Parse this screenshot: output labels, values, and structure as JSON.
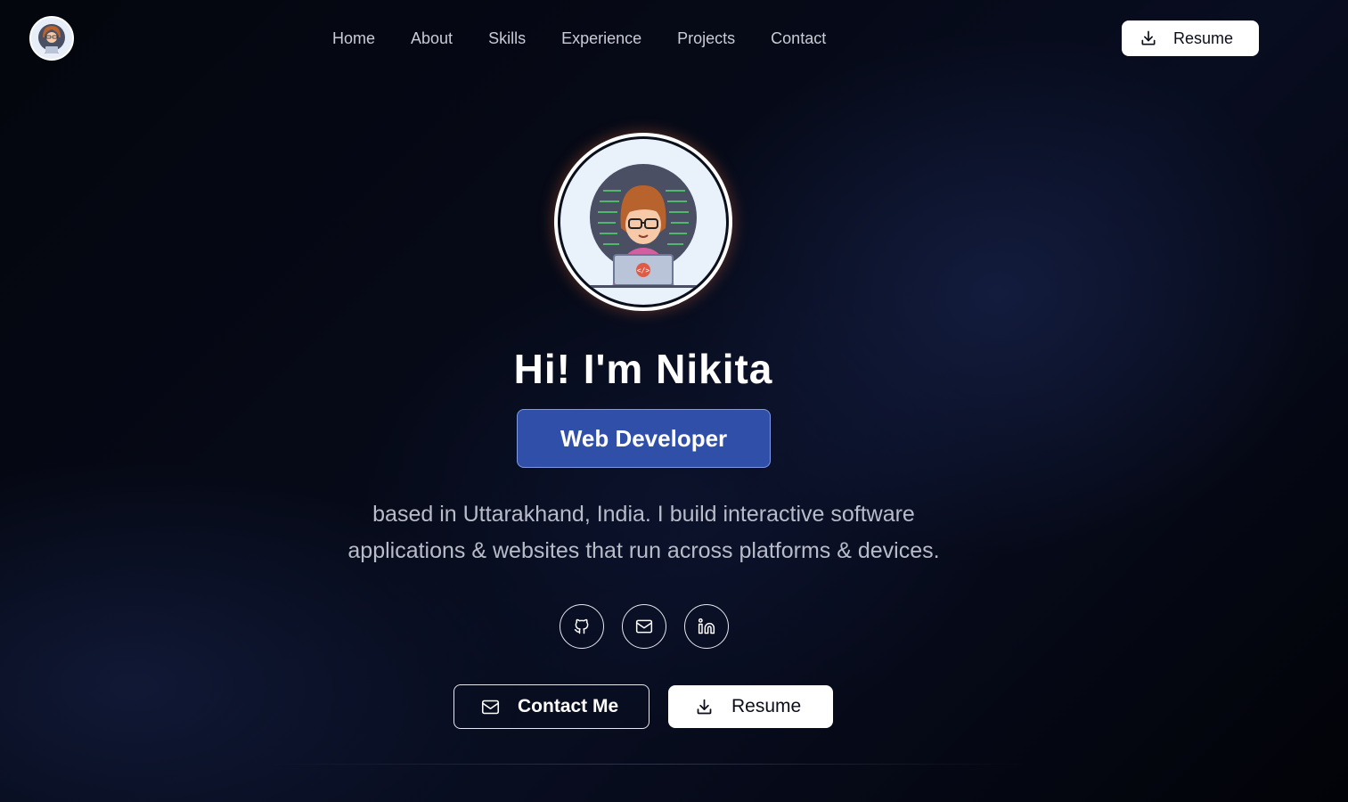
{
  "header": {
    "logo_icon": "avatar-icon",
    "nav": [
      "Home",
      "About",
      "Skills",
      "Experience",
      "Projects",
      "Contact"
    ],
    "resume_label": "Resume",
    "resume_icon": "download-icon"
  },
  "hero": {
    "title": "Hi! I'm Nikita",
    "role": "Web Developer",
    "bio_line1": "based in Uttarakhand, India. I build interactive software",
    "bio_line2": "applications & websites that run across platforms & devices.",
    "socials": [
      "github-icon",
      "mail-icon",
      "linkedin-icon"
    ],
    "contact_label": "Contact Me",
    "resume_label": "Resume"
  },
  "colors": {
    "accent": "#2f4fa9",
    "background": "#05070f",
    "text_muted": "#b8bcc9"
  }
}
